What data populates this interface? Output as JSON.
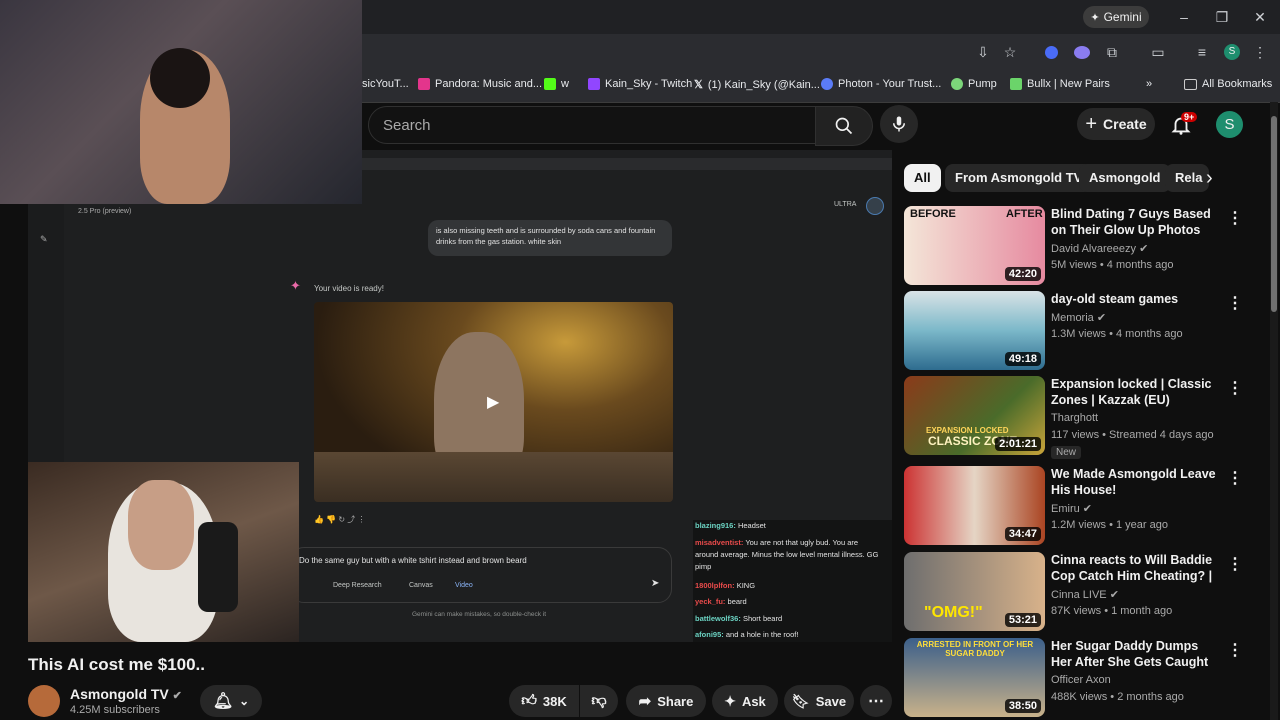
{
  "browser": {
    "gemini_label": "Gemini",
    "bookmarks": [
      {
        "label": "sicYouT...",
        "color": "#c00"
      },
      {
        "label": "Pandora: Music and...",
        "color": "#e3358c"
      },
      {
        "label": "w",
        "color": "#53fc18"
      },
      {
        "label": "Kain_Sky - Twitch",
        "color": "#9146ff"
      },
      {
        "label": "(1) Kain_Sky (@Kain...",
        "color": "#ffffff"
      },
      {
        "label": "Photon - Your Trust...",
        "color": "#5b7cf7"
      },
      {
        "label": "Pump",
        "color": "#7cd67a"
      },
      {
        "label": "Bullx | New Pairs",
        "color": "#6bd46a"
      }
    ],
    "all_bookmarks": "All Bookmarks",
    "profile_initial": "S"
  },
  "header": {
    "search_placeholder": "Search",
    "create_label": "Create",
    "notif_count": "9+",
    "avatar_initial": "S"
  },
  "filters": {
    "chips": [
      "All",
      "From Asmongold TV",
      "Asmongold",
      "Rela"
    ]
  },
  "video_inner": {
    "model_label": "2.5 Pro (preview)",
    "ultra_label": "ULTRA",
    "prompt_bubble": "is also missing teeth and is surrounded by soda cans and fountain drinks from the gas station. white skin",
    "ready_text": "Your video is ready!",
    "input_text": "Do the same guy but with a white tshirt instead and brown beard",
    "tools": [
      "Deep Research",
      "Canvas",
      "Video"
    ],
    "disclaimer": "Gemini can make mistakes, so double-check it",
    "chat": [
      {
        "user": "blazing916:",
        "msg": "Headset",
        "color": "#6bd2c2"
      },
      {
        "user": "misadventist:",
        "msg": "You are not that ugly bud. You are",
        "color": "#e94b4b"
      },
      {
        "user": "",
        "msg": "around average. Minus the low level mental illness. GG",
        "color": "#e94b4b"
      },
      {
        "user": "",
        "msg": "pimp",
        "color": "#e94b4b"
      },
      {
        "user": "1800lplfon:",
        "msg": "KING",
        "color": "#e94b4b"
      },
      {
        "user": "yeck_fu:",
        "msg": "beard",
        "color": "#e94b4b"
      },
      {
        "user": "battlewolf36:",
        "msg": "Short beard",
        "color": "#6bd2c2"
      },
      {
        "user": "afoni95:",
        "msg": "and a hole in the roof!",
        "color": "#6bd2c2"
      }
    ]
  },
  "video": {
    "title": "This AI cost me $100..",
    "channel": "Asmongold TV",
    "subscribers": "4.25M subscribers",
    "likes": "38K",
    "share_label": "Share",
    "ask_label": "Ask",
    "save_label": "Save"
  },
  "recommendations": [
    {
      "title": "Blind Dating 7 Guys Based on Their Glow Up Photos",
      "channel": "David Alvareeezy",
      "verified": true,
      "meta": "5M views • 4 months ago",
      "duration": "42:20",
      "thumb_text_left": "BEFORE",
      "thumb_text_right": "AFTER",
      "colors": [
        "#f4e6d8",
        "#e68aa0"
      ]
    },
    {
      "title": "day-old steam games",
      "channel": "Memoria",
      "verified": true,
      "meta": "1.3M views • 4 months ago",
      "duration": "49:18",
      "colors": [
        "#7bb8c9",
        "#2e6c8f"
      ]
    },
    {
      "title": "Expansion locked | Classic Zones | Kazzak (EU)",
      "channel": "Tharghott",
      "verified": false,
      "meta": "117 views • Streamed 4 days ago",
      "duration": "2:01:21",
      "thumb_text_left": "EXPANSION LOCKED",
      "thumb_text_right": "CLASSIC ZONE",
      "badge": "New",
      "colors": [
        "#4a6b2a",
        "#8b3a1a"
      ]
    },
    {
      "title": "We Made Asmongold Leave His House!",
      "channel": "Emiru",
      "verified": true,
      "meta": "1.2M views • 1 year ago",
      "duration": "34:47",
      "colors": [
        "#c33",
        "#e5d5c5"
      ]
    },
    {
      "title": "Cinna reacts to Will Baddie Cop Catch Him Cheating? | UDY ...",
      "channel": "Cinna LIVE",
      "verified": true,
      "meta": "87K views • 1 month ago",
      "duration": "53:21",
      "thumb_text_left": "\"OMG!\"",
      "colors": [
        "#6e6e6e",
        "#d8b28a"
      ]
    },
    {
      "title": "Her Sugar Daddy Dumps Her After She Gets Caught Using a...",
      "channel": "Officer Axon",
      "verified": false,
      "meta": "488K views • 2 months ago",
      "duration": "38:50",
      "thumb_text_left": "ARRESTED IN FRONT OF HER SUGAR DADDY",
      "colors": [
        "#3b5f8a",
        "#c9b28a"
      ]
    }
  ]
}
